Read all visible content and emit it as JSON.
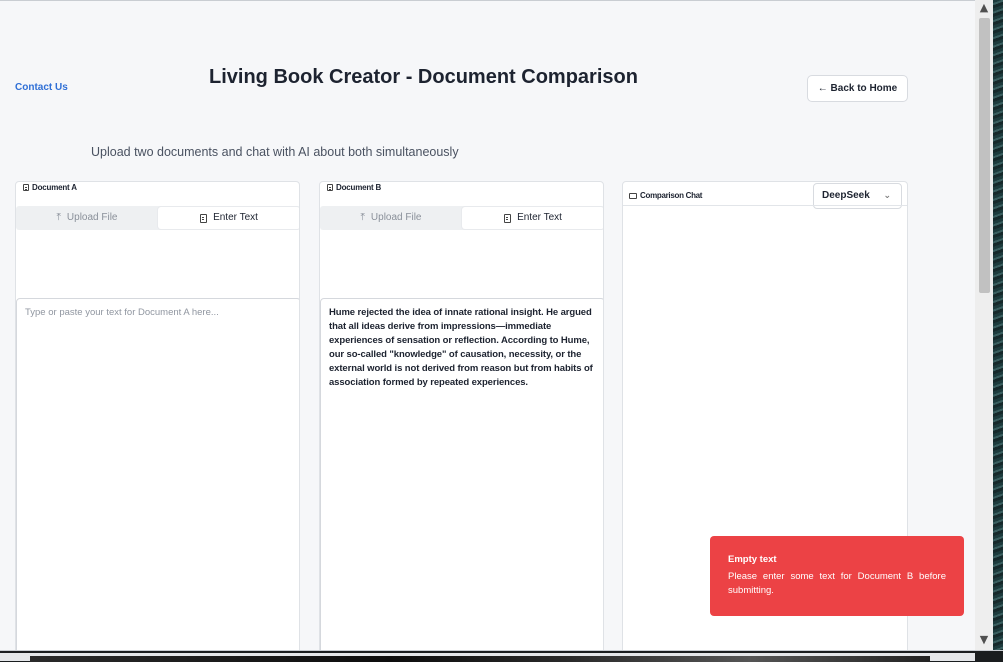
{
  "header": {
    "contact_label": "Contact Us",
    "title": "Living Book Creator - Document Comparison",
    "back_label": "← Back to Home",
    "subtitle": "Upload two documents and chat with AI about both simultaneously"
  },
  "document_a": {
    "title": "Document A",
    "tabs": [
      {
        "label": "Upload File",
        "icon": "upload-icon",
        "active": false
      },
      {
        "label": "Enter Text",
        "icon": "file-text-icon",
        "active": true
      }
    ],
    "text_value": "",
    "placeholder": "Type or paste your text for Document A here..."
  },
  "document_b": {
    "title": "Document B",
    "tabs": [
      {
        "label": "Upload File",
        "icon": "upload-icon",
        "active": false
      },
      {
        "label": "Enter Text",
        "icon": "file-text-icon",
        "active": true
      }
    ],
    "text_value": "Hume rejected the idea of innate rational insight. He argued that all ideas derive from impressions—immediate experiences of sensation or reflection. According to Hume, our so-called \"knowledge\" of causation, necessity, or the external world is not derived from reason but from habits of association formed by repeated experiences."
  },
  "chat": {
    "title": "Comparison Chat",
    "model_selected": "DeepSeek"
  },
  "toast": {
    "title": "Empty text",
    "message": "Please enter some text for Document B before submitting.",
    "color": "#ec4245"
  }
}
